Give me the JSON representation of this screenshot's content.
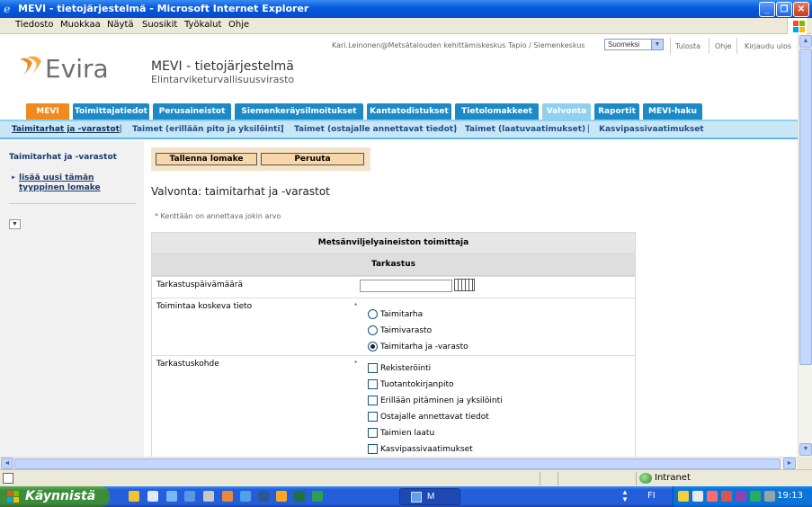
{
  "window": {
    "title": "MEVI - tietojärjestelmä - Microsoft Internet Explorer",
    "minimize": "_",
    "maximize": "❐",
    "close": "✕"
  },
  "menu": [
    "Tiedosto",
    "Muokkaa",
    "Näytä",
    "Suosikit",
    "Työkalut",
    "Ohje"
  ],
  "header": {
    "user": "Kari.Leinonen@Metsätalouden kehittämiskeskus Tapio / Siemenkeskus",
    "language": "Suomeksi",
    "links": [
      "Tulosta",
      "Ohje",
      "Kirjaudu ulos"
    ],
    "logo_text": "Evira",
    "app_title": "MEVI - tietojärjestelmä",
    "app_subtitle": "Elintarviketurvallisuusvirasto"
  },
  "tabs": [
    "MEVI",
    "Toimittajatiedot",
    "Perusaineistot",
    "Siemenkeräysilmoitukset",
    "Kantatodistukset",
    "Tietolomakkeet",
    "Valvonta",
    "Raportit",
    "MEVI-haku"
  ],
  "subnav": [
    "Taimitarhat ja -varastot",
    "Taimet (erillään pito ja yksilöinti)",
    "Taimet (ostajalle annettavat tiedot)",
    "Taimet (laatuvaatimukset)",
    "Kasvipassivaatimukset"
  ],
  "sidebar": {
    "title": "Taimitarhat ja -varastot",
    "link": "lisää uusi tämän tyyppinen lomake"
  },
  "buttons": {
    "save": "Tallenna lomake",
    "cancel": "Peruuta"
  },
  "form": {
    "heading": "Valvonta: taimitarhat ja -varastot",
    "required_note": "* Kenttään on annettava jokin arvo",
    "section_title": "Metsänviljelyaineiston toimittaja",
    "subsection_title": "Tarkastus",
    "date_label": "Tarkastuspäivämäärä",
    "date_value": "",
    "activity_label": "Toimintaa koskeva tieto",
    "activity_options": [
      "Taimitarha",
      "Taimivarasto",
      "Taimitarha ja -varasto"
    ],
    "activity_selected": 2,
    "target_label": "Tarkastuskohde",
    "target_options": [
      "Rekisteröinti",
      "Tuotantokirjanpito",
      "Erillään pitäminen ja yksilöinti",
      "Ostajalle annettavat tiedot",
      "Taimien laatu",
      "Kasvipassivaatimukset"
    ],
    "required_mark": "*"
  },
  "statusbar": {
    "zone": "Intranet"
  },
  "taskbar": {
    "start": "Käynnistä",
    "task": "M",
    "language": "FI",
    "clock": "19:13"
  },
  "colors": {
    "tab_blue": "#1d8ac8",
    "tab_orange": "#f08a1c",
    "tab_active": "#8fd0f0",
    "subnav_bg": "#c8e6f5",
    "button_bg": "#f9d6a8"
  }
}
